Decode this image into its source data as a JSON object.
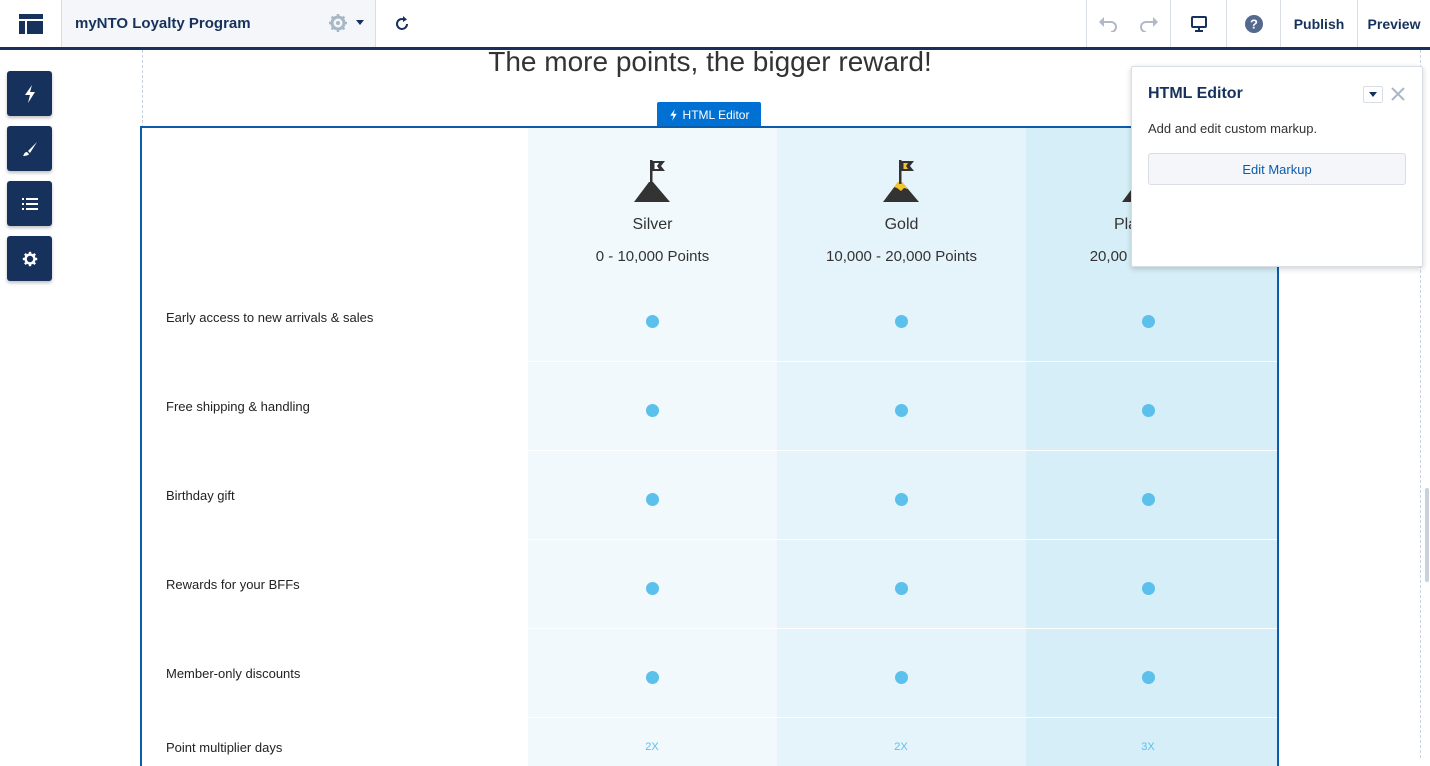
{
  "topbar": {
    "site_name": "myNTO Loyalty Program",
    "publish_label": "Publish",
    "preview_label": "Preview"
  },
  "rail": {
    "items": [
      "lightning-icon",
      "brush-icon",
      "list-icon",
      "gear-icon"
    ]
  },
  "page": {
    "headline": "The more points, the bigger reward!"
  },
  "component": {
    "label": "HTML Editor"
  },
  "tiers": [
    {
      "name": "Silver",
      "range": "0 - 10,000 Points",
      "flag_color": "#ffffff"
    },
    {
      "name": "Gold",
      "range": "10,000 - 20,000 Points",
      "flag_color": "#f4c430"
    },
    {
      "name": "Pla",
      "range": "20,00",
      "flag_color": "#ffffff"
    }
  ],
  "benefits": [
    {
      "label": "Early access to new arrivals & sales",
      "values": [
        "dot",
        "dot",
        "dot"
      ]
    },
    {
      "label": "Free shipping & handling",
      "values": [
        "dot",
        "dot",
        "dot"
      ]
    },
    {
      "label": "Birthday gift",
      "values": [
        "dot",
        "dot",
        "dot"
      ]
    },
    {
      "label": "Rewards for your BFFs",
      "values": [
        "dot",
        "dot",
        "dot"
      ]
    },
    {
      "label": "Member-only discounts",
      "values": [
        "dot",
        "dot",
        "dot"
      ]
    },
    {
      "label": "Point multiplier days",
      "values": [
        "2X",
        "2X",
        "3X"
      ]
    }
  ],
  "popup": {
    "title": "HTML Editor",
    "description": "Add and edit custom markup.",
    "button_label": "Edit Markup"
  },
  "colors": {
    "brand_navy": "#16325c",
    "accent_blue": "#0070d2",
    "dot_blue": "#5bc0eb"
  }
}
